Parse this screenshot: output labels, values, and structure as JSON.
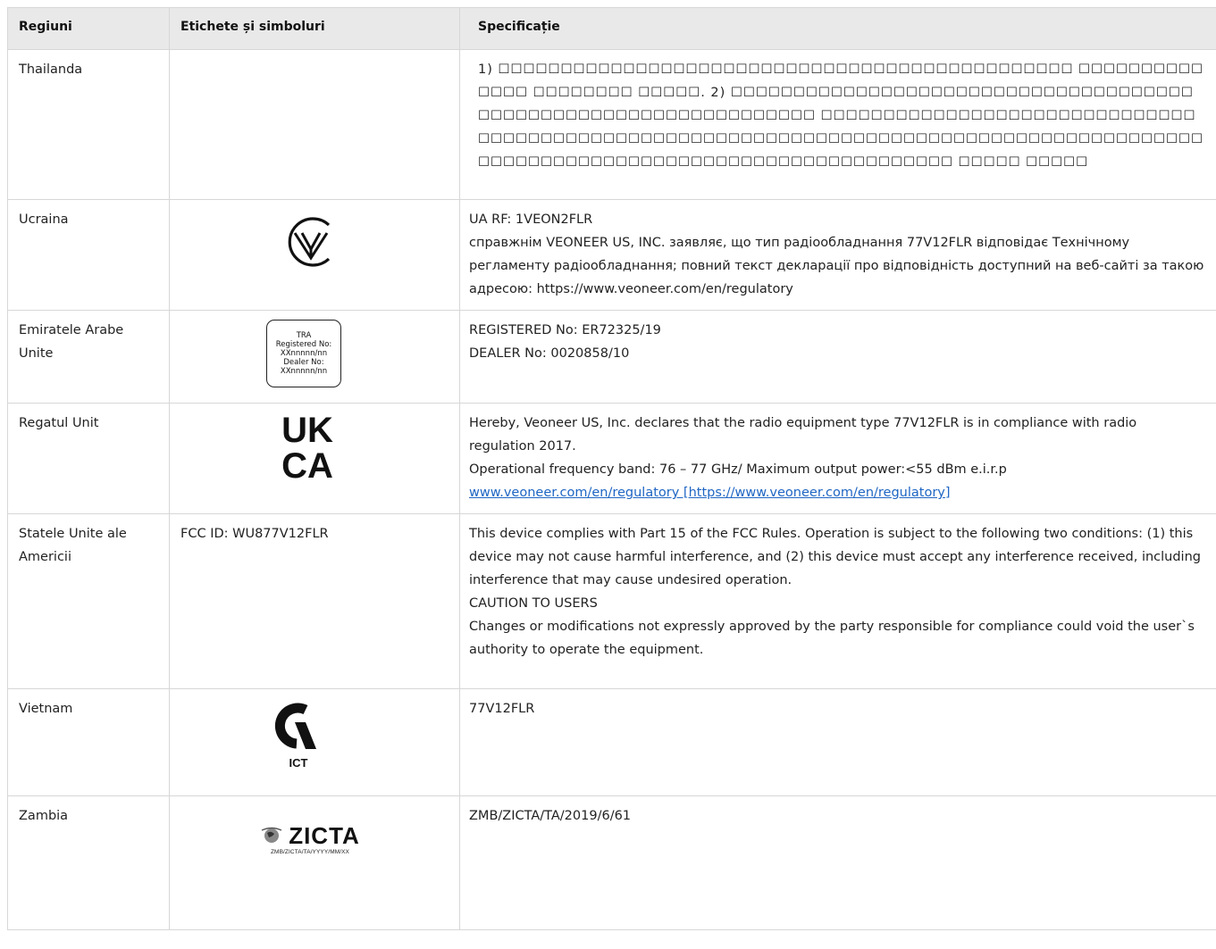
{
  "headers": {
    "region": "Regiuni",
    "labels": "Etichete și simboluri",
    "spec": "Specificație"
  },
  "rows": [
    {
      "region": "Thailanda",
      "labels": "",
      "spec": "1) ☐☐☐☐☐☐☐☐☐☐☐☐☐☐☐☐☐☐☐☐☐☐☐☐☐☐☐☐☐☐☐☐☐☐☐☐☐☐☐☐☐☐☐☐☐☐ ☐☐☐☐☐☐☐☐☐☐☐☐☐☐ ☐☐☐☐☐☐☐☐ ☐☐☐☐☐. 2) ☐☐☐☐☐☐☐☐☐☐☐☐☐☐☐☐☐☐☐☐☐☐☐☐☐☐☐☐☐☐☐☐☐☐☐☐☐☐☐☐☐☐☐☐☐☐☐☐☐☐☐☐☐☐☐☐☐☐☐☐☐☐☐☐ ☐☐☐☐☐☐☐☐☐☐☐☐☐☐☐☐☐☐☐☐☐☐☐☐☐☐☐☐☐☐☐☐☐☐☐☐☐☐☐☐☐☐☐☐☐☐☐☐☐☐☐☐☐☐☐☐☐☐☐☐☐☐☐☐☐☐☐☐☐☐☐☐☐☐☐☐☐☐☐☐☐☐☐☐☐☐☐☐☐☐☐☐☐☐☐☐☐☐☐☐☐☐☐☐☐☐☐☐☐☐☐☐☐☐☐☐☐☐☐☐☐☐☐☐☐☐ ☐☐☐☐☐ ☐☐☐☐☐"
    },
    {
      "region": "Ucraina",
      "labels_icon": "ukraine-conformity-mark-icon",
      "spec_lines": [
        "UA RF: 1VEON2FLR",
        "справжнім VEONEER US, INC. заявляє, що тип радіообладнання 77V12FLR відповідає Технічному регламенту радіообладнання; повний текст декларації про відповідність доступний на веб-сайті за такою адресою: https://www.veoneer.com/en/regulatory"
      ]
    },
    {
      "region": "Emiratele Arabe Unite",
      "labels_box": [
        "TRA",
        "Registered No:",
        "XXnnnnn/nn",
        "Dealer No:",
        "XXnnnnn/nn"
      ],
      "spec_lines": [
        "REGISTERED No: ER72325/19",
        "DEALER No: 0020858/10"
      ]
    },
    {
      "region": "Regatul Unit",
      "labels_logo": [
        "UK",
        "CA"
      ],
      "spec_lines": [
        "Hereby, Veoneer US, Inc. declares that the radio equipment type 77V12FLR is in compliance with radio regulation 2017.",
        "Operational frequency band: 76 – 77 GHz/ Maximum output power:<55 dBm e.i.r.p"
      ],
      "spec_link": "www.veoneer.com/en/regulatory [https://www.veoneer.com/en/regulatory]"
    },
    {
      "region": "Statele Unite ale Americii",
      "labels": "FCC ID: WU877V12FLR",
      "spec_lines": [
        "This device complies with Part 15 of the FCC Rules. Operation is subject to the following two conditions: (1) this device may not cause harmful interference, and (2) this device must accept any interference received, including interference that may cause undesired operation.",
        "CAUTION TO USERS",
        "Changes or modifications not expressly approved by the party responsible for compliance could void the user`s authority to operate the equipment."
      ]
    },
    {
      "region": "Vietnam",
      "labels_logo_text": "ICT",
      "spec": "77V12FLR"
    },
    {
      "region": "Zambia",
      "labels_logo": {
        "word": "ZICTA",
        "sub": "ZMB/ZICTA/TA/YYYY/MM/XX"
      },
      "spec": "ZMB/ZICTA/TA/2019/6/61"
    }
  ],
  "colors": {
    "header_bg": "#e9e9e9",
    "border": "#d7d7d7",
    "link": "#1f66c4"
  }
}
